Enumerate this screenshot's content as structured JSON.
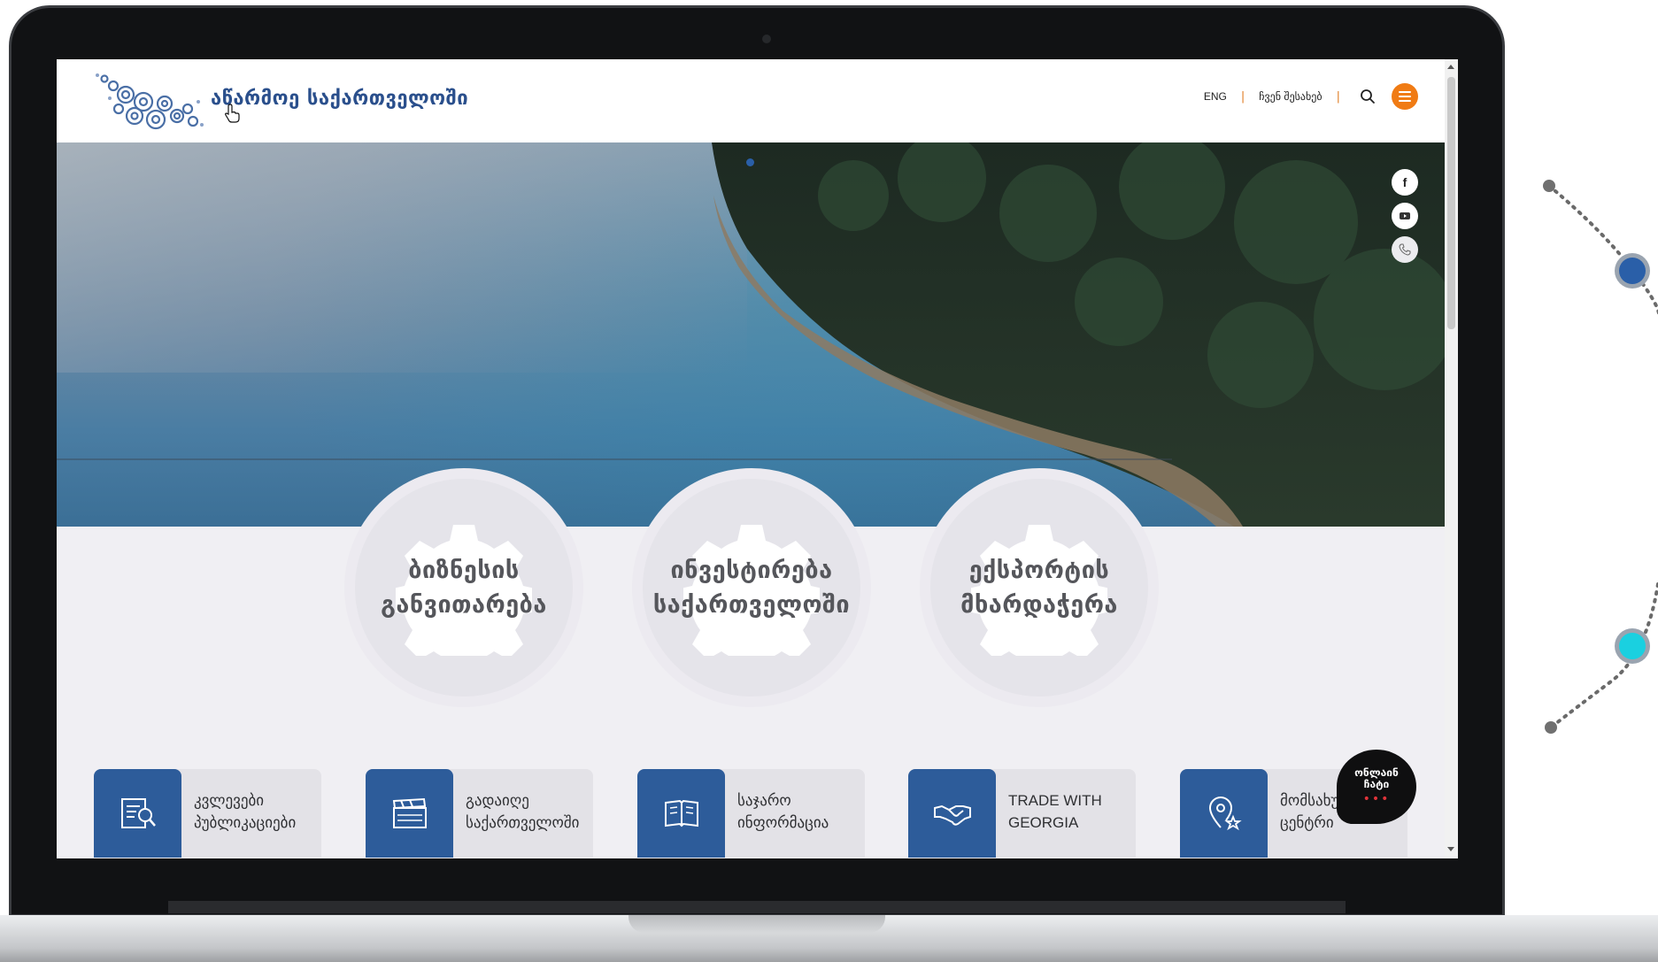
{
  "header": {
    "logo_text": "აწარმოე საქართველოში",
    "nav": {
      "lang": "ENG",
      "separator": "|",
      "my_site": "ჩვენ შესახებ"
    }
  },
  "social": [
    "facebook-icon",
    "youtube-icon",
    "phone-icon"
  ],
  "social_labels": {
    "facebook": "f",
    "youtube": "▶",
    "phone": "✆"
  },
  "pillars": [
    {
      "line1": "ბიზნესის",
      "line2": "განვითარება"
    },
    {
      "line1": "ინვესტირება",
      "line2": "საქართველოში"
    },
    {
      "line1": "ექსპორტის",
      "line2": "მხარდაჭერა"
    }
  ],
  "tiles": [
    {
      "line1": "კვლევები",
      "line2": "პუბლიკაციები",
      "icon": "research-icon"
    },
    {
      "line1": "გადაიღე",
      "line2": "საქართველოში",
      "icon": "clapperboard-icon"
    },
    {
      "line1": "საჯარო",
      "line2": "ინფორმაცია",
      "icon": "book-icon"
    },
    {
      "line1": "TRADE WITH",
      "line2": "GEORGIA",
      "icon": "handshake-icon"
    },
    {
      "line1": "მომსახურე",
      "line2": "ცენტრი",
      "icon": "location-star-icon"
    }
  ],
  "chat": {
    "line1": "ონლაინ",
    "line2": "ჩატი",
    "dots": "•••"
  },
  "colors": {
    "brand_blue": "#2d5c9a",
    "accent_orange": "#f07b14",
    "deco_blue": "#2a5fa8",
    "deco_cyan": "#1ad0e0"
  }
}
